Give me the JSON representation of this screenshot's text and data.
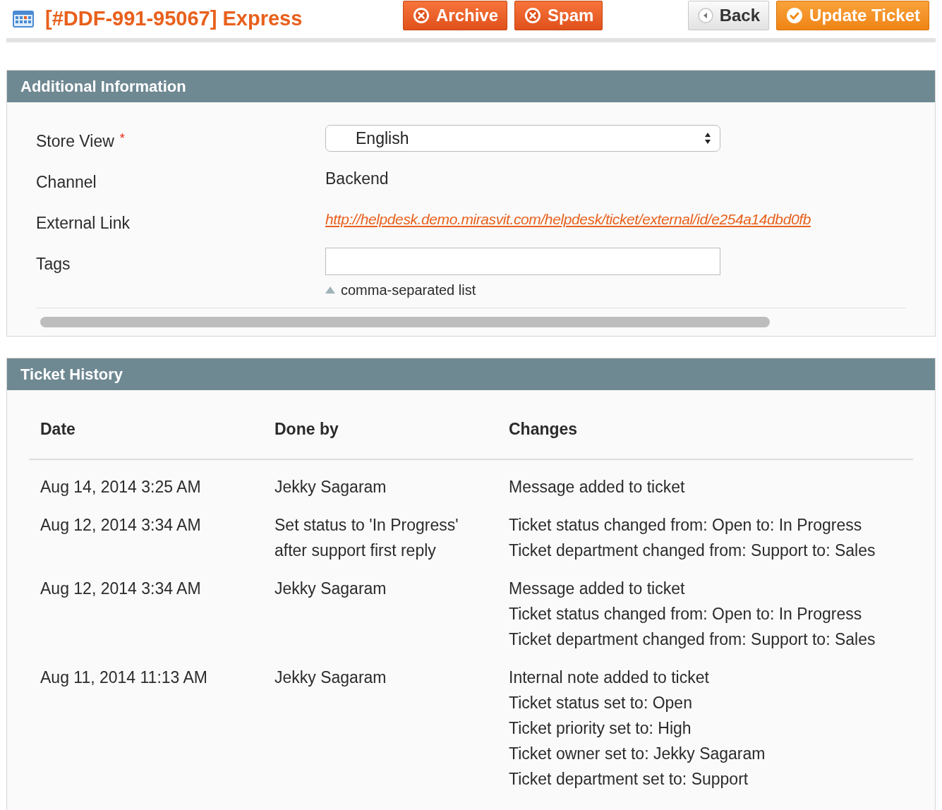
{
  "header": {
    "title": "[#DDF-991-95067] Express",
    "buttons": [
      {
        "label": "Archive",
        "kind": "danger"
      },
      {
        "label": "Spam",
        "kind": "danger"
      },
      {
        "label": "Back",
        "kind": "default"
      },
      {
        "label": "Update Ticket",
        "kind": "primary"
      }
    ]
  },
  "additional_information": {
    "title": "Additional Information",
    "fields": [
      {
        "label": "Store View",
        "required_mark": "*",
        "kind": "select",
        "value": "English"
      },
      {
        "label": "Channel",
        "kind": "text",
        "value": "Backend"
      },
      {
        "label": "External Link",
        "kind": "link",
        "value": "http://helpdesk.demo.mirasvit.com/helpdesk/ticket/external/id/e254a14dbd0fb"
      },
      {
        "label": "Tags",
        "kind": "input",
        "hint": "comma-separated list"
      }
    ]
  },
  "ticket_history": {
    "title": "Ticket History",
    "columns": [
      "Date",
      "Done by",
      "Changes"
    ],
    "rows": [
      {
        "date": "Aug 14, 2014 3:25 AM",
        "done_by": [
          "Jekky Sagaram"
        ],
        "changes": [
          "Message added to ticket"
        ]
      },
      {
        "date": "Aug 12, 2014 3:34 AM",
        "done_by": [
          "Set status to 'In Progress'",
          "after support first reply"
        ],
        "changes": [
          "Ticket status changed from: Open to: In Progress",
          "Ticket department changed from: Support to: Sales"
        ]
      },
      {
        "date": "Aug 12, 2014 3:34 AM",
        "done_by": [
          "Jekky Sagaram"
        ],
        "changes": [
          "Message added to ticket",
          "Ticket status changed from: Open to: In Progress",
          "Ticket department changed from: Support to: Sales"
        ]
      },
      {
        "date": "Aug 11, 2014 11:13 AM",
        "done_by": [
          "Jekky Sagaram"
        ],
        "changes": [
          "Internal note added to ticket",
          "Ticket status set to: Open",
          "Ticket priority set to: High",
          "Ticket owner set to: Jekky Sagaram",
          "Ticket department set to: Support"
        ]
      }
    ]
  }
}
